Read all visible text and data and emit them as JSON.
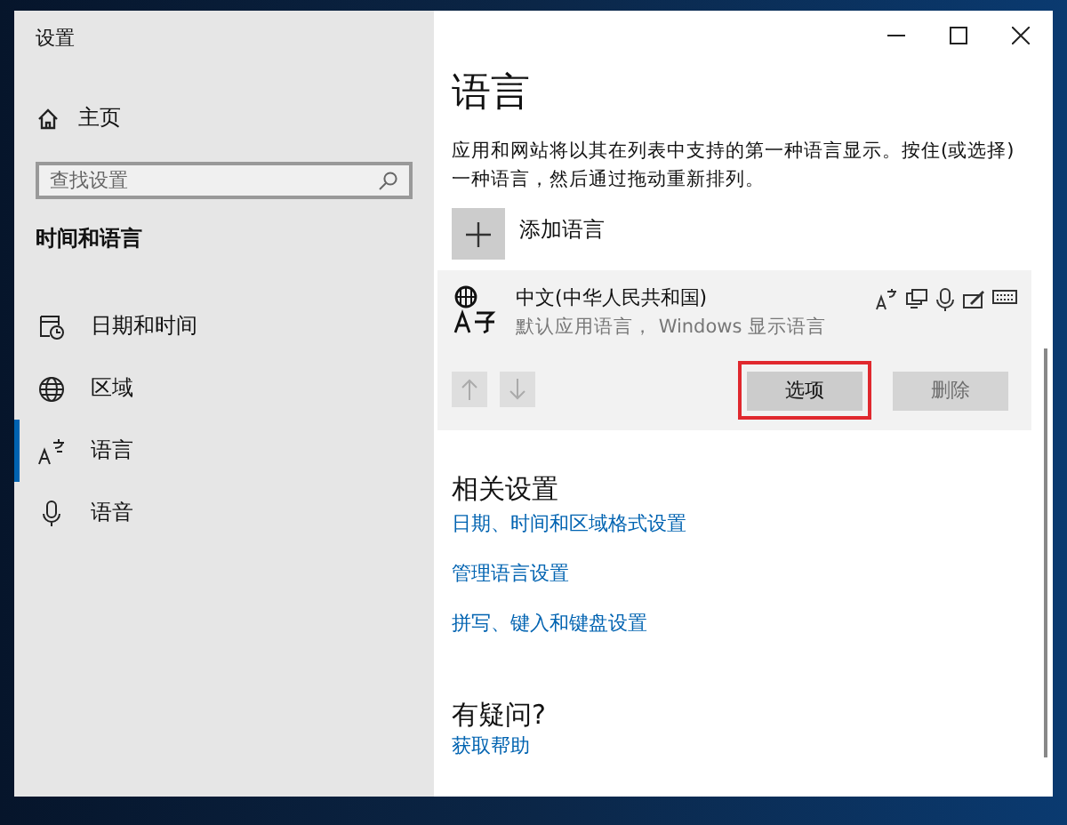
{
  "window": {
    "title": "设置"
  },
  "sidebar": {
    "home": "主页",
    "search": {
      "placeholder": "查找设置"
    },
    "section": "时间和语言",
    "items": [
      {
        "label": "日期和时间",
        "kind": "clock",
        "selected": false
      },
      {
        "label": "区域",
        "kind": "globe",
        "selected": false
      },
      {
        "label": "语言",
        "kind": "language",
        "selected": true
      },
      {
        "label": "语音",
        "kind": "mic",
        "selected": false
      }
    ]
  },
  "main": {
    "title": "语言",
    "description": "应用和网站将以其在列表中支持的第一种语言显示。按住(或选择)一种语言，然后通过拖动重新排列。",
    "add_language": "添加语言",
    "languages": [
      {
        "name": "中文(中华人民共和国)",
        "subtitle": "默认应用语言， Windows 显示语言",
        "move_up_disabled": true,
        "move_down_disabled": true,
        "buttons": [
          {
            "label": "选项",
            "disabled": false,
            "highlighted": true
          },
          {
            "label": "删除",
            "disabled": true,
            "highlighted": false
          }
        ]
      }
    ],
    "related": {
      "heading": "相关设置",
      "links": [
        "日期、时间和区域格式设置",
        "管理语言设置",
        "拼写、键入和键盘设置"
      ]
    },
    "help": {
      "heading": "有疑问?",
      "link": "获取帮助"
    }
  }
}
